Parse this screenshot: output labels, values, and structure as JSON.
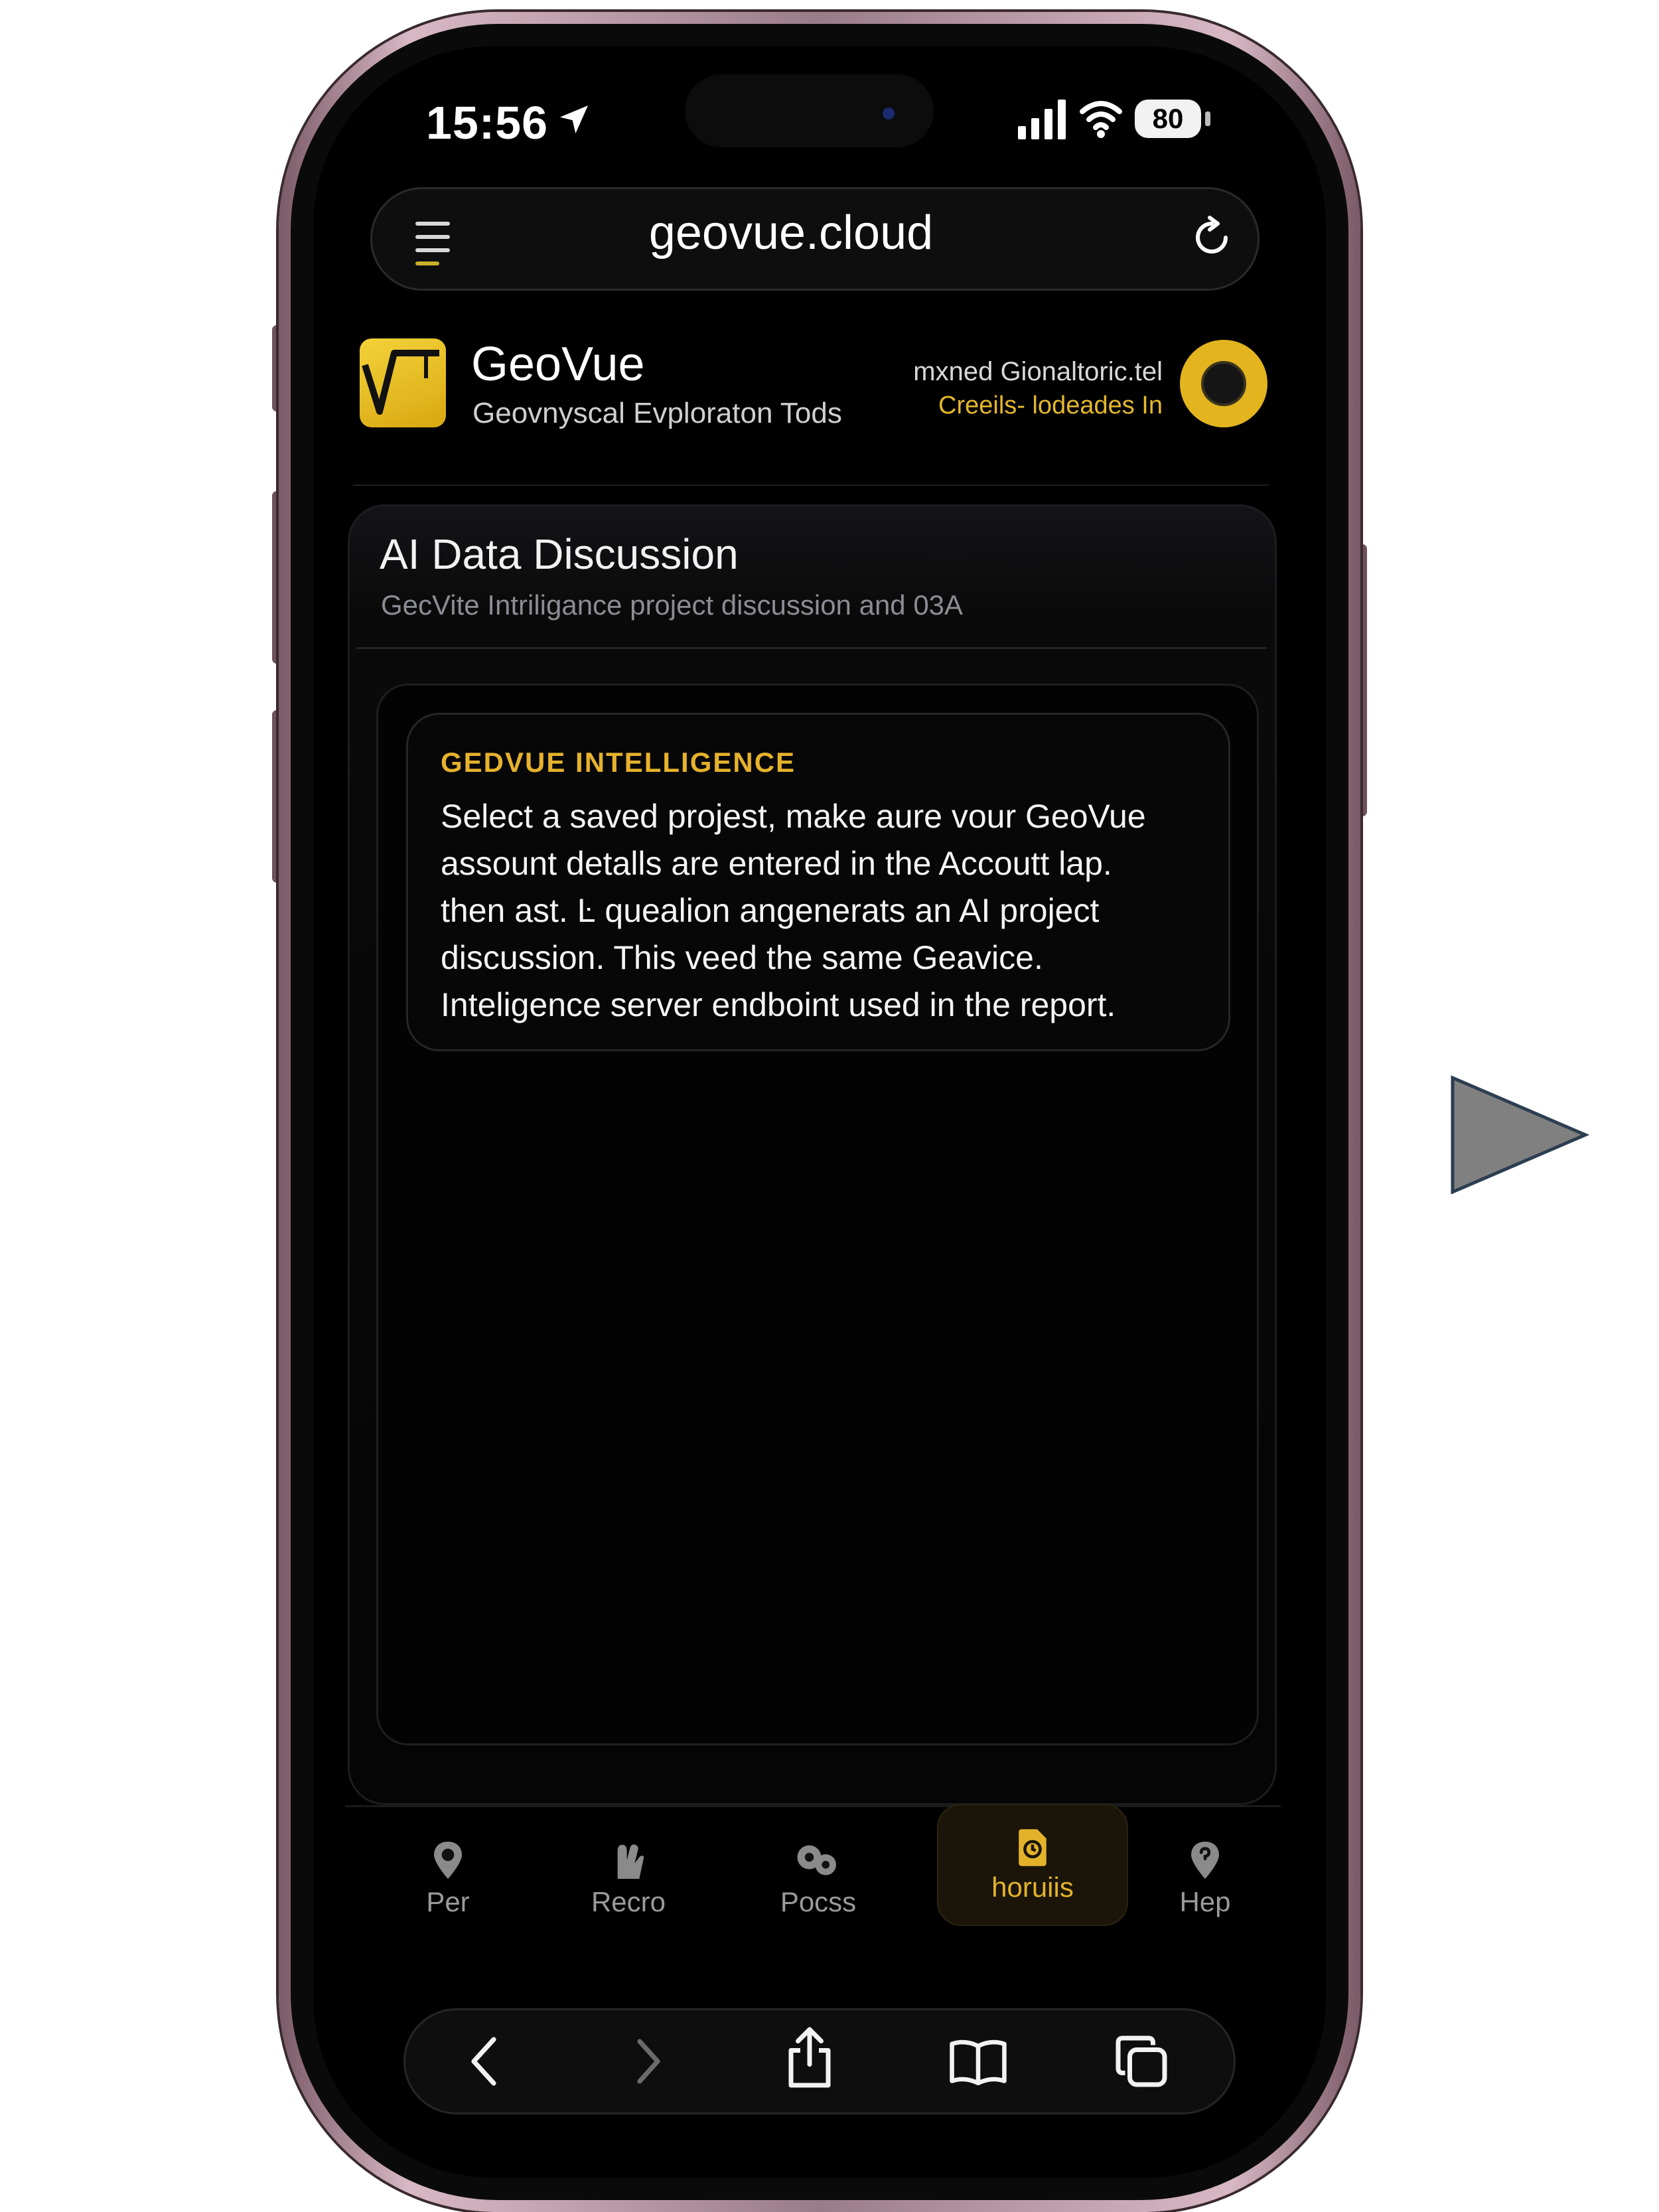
{
  "status_bar": {
    "time": "15:56",
    "battery": "80"
  },
  "browser": {
    "url": "geovue.cloud"
  },
  "app": {
    "title": "GeoVue",
    "subtitle": "Geovnyscal Evploraton Tods",
    "header_line1": "mxned Gionaltoric.tel",
    "header_line2": "Creeils- lodeades In",
    "accent_color": "#e4b22a"
  },
  "panel": {
    "title": "AI Data Discussion",
    "subtitle": "GecVite Intriligance project discussion and 03A"
  },
  "card": {
    "title": "GEDVUE INTELLIGENCE",
    "body_lines": [
      "Select a saved projest, make aure vour GeoVue",
      "assount detalls are entered in the Accoutt lap.",
      "then ast. Ŀ quealion angenerats an AI project",
      "discussion. This veed the same Geavice.",
      "Inteligence server endboint used in the report."
    ]
  },
  "tabs": [
    {
      "label": "Per",
      "icon": "pin-icon",
      "active": false
    },
    {
      "label": "Recro",
      "icon": "hand-icon",
      "active": false
    },
    {
      "label": "Pocss",
      "icon": "link-icon",
      "active": false
    },
    {
      "label": "horuiis",
      "icon": "document-icon",
      "active": true
    },
    {
      "label": "Hep",
      "icon": "help-pin-icon",
      "active": false
    }
  ],
  "toolbar": {
    "icons": [
      "back-icon",
      "forward-icon",
      "share-icon",
      "bookmarks-icon",
      "tabs-icon"
    ]
  }
}
